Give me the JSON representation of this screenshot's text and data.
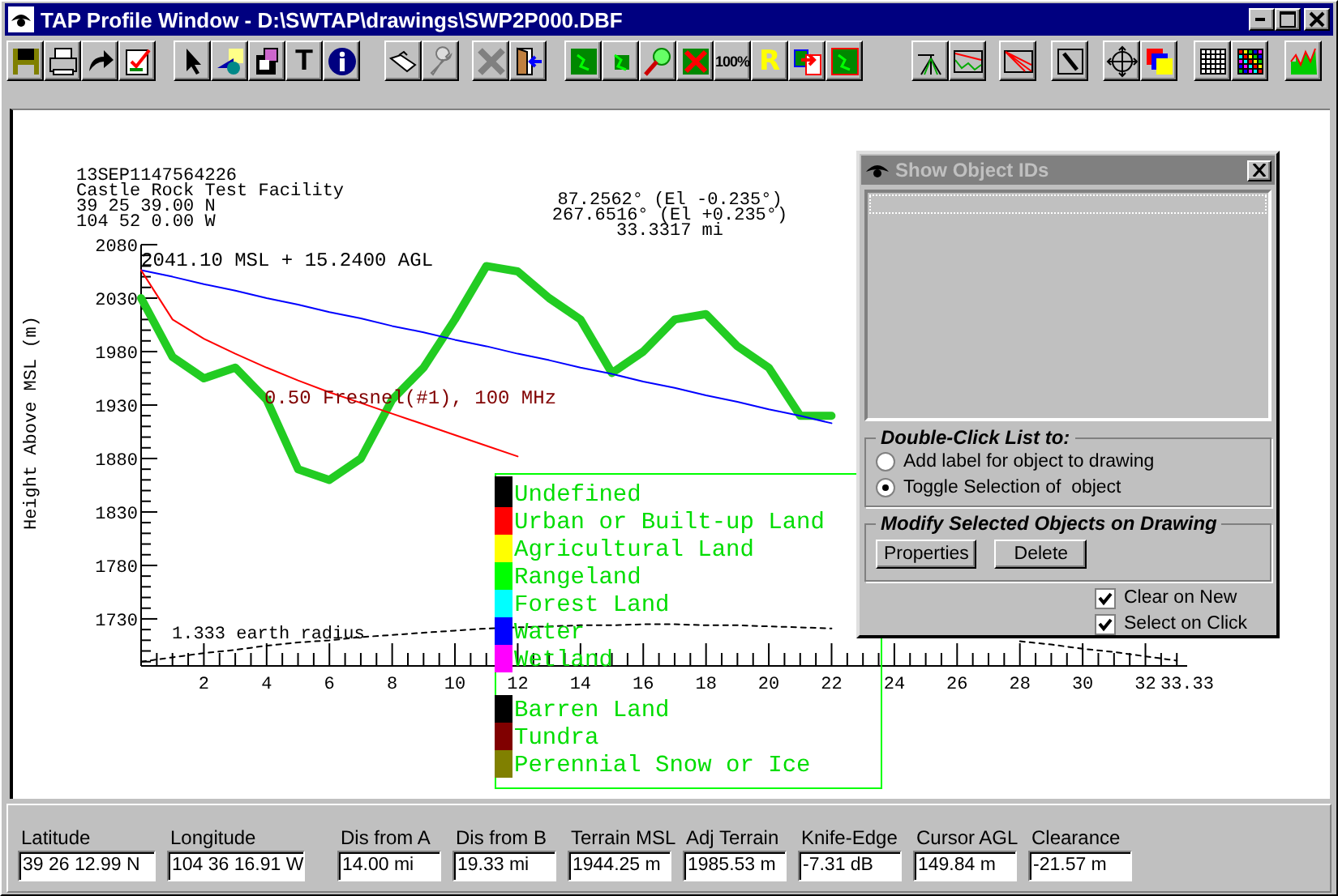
{
  "window": {
    "title": "TAP Profile Window - D:\\SWTAP\\drawings\\SWP2P000.DBF"
  },
  "toolbar": {
    "text_buttons": [
      "T",
      "100%",
      "R"
    ]
  },
  "plot": {
    "header_left": [
      "13SEP1147564226",
      "Castle Rock Test Facility",
      " 39 25 39.00 N",
      "104 52 0.00 W"
    ],
    "header_right": [
      "87.2562° (El -0.235°)",
      "267.6516° (El +0.235°)",
      "33.3317 mi"
    ],
    "antenna_label": "2041.10 MSL + 15.2400 AGL",
    "chart_data": {
      "type": "line",
      "ylabel": "Height Above MSL (m)",
      "x": [
        0,
        1,
        2,
        3,
        4,
        5,
        6,
        7,
        8,
        9,
        10,
        11,
        12,
        13,
        14,
        15,
        16,
        17,
        18,
        19,
        20,
        21,
        22,
        23,
        24,
        25,
        26,
        27,
        28,
        29,
        30,
        31,
        32,
        33
      ],
      "series": [
        {
          "line_style": "solid",
          "color": "#22cc22",
          "values": [
            2030,
            1975,
            1955,
            1965,
            1935,
            1870,
            1860,
            1880,
            1935,
            1965,
            2010,
            2060,
            2055,
            2030,
            2010,
            1960,
            1980,
            2010,
            2015,
            1985,
            1965,
            1920,
            1920,
            null,
            null,
            null,
            null,
            null,
            null,
            null,
            null,
            null,
            null,
            null
          ]
        },
        {
          "line_style": "solid",
          "color": "#0000ff",
          "values": [
            2056,
            2050,
            2043,
            2037,
            2030,
            2024,
            2017,
            2011,
            2004,
            1998,
            1991,
            1985,
            1978,
            1972,
            1965,
            1959,
            1952,
            1946,
            1939,
            1933,
            1926,
            1920,
            1913,
            null,
            null,
            null,
            null,
            null,
            null,
            null,
            null,
            null,
            null,
            null
          ]
        },
        {
          "name": "0.50 Fresnel(#1), 100 MHz",
          "line_style": "solid",
          "color": "#ff0000",
          "values": [
            2056,
            2010,
            1992,
            1978,
            1965,
            1953,
            1942,
            1932,
            1922,
            1912,
            1902,
            1892,
            1882,
            null,
            null,
            null,
            null,
            null,
            null,
            null,
            null,
            null,
            null,
            null,
            null,
            null,
            null,
            null,
            null,
            null,
            null,
            null,
            null,
            null
          ]
        },
        {
          "name": "1.333 earth radius",
          "line_style": "dashed",
          "color": "#000000",
          "values": [
            1690,
            1694,
            1698,
            1701,
            1705,
            1708,
            1710,
            1713,
            1715,
            1717,
            1719,
            1721,
            1722,
            1723,
            1724,
            1724,
            1725,
            1725,
            1724,
            1724,
            1723,
            1722,
            1721,
            null,
            null,
            null,
            null,
            null,
            1709,
            1706,
            1702,
            1699,
            1695,
            1691
          ]
        }
      ],
      "xlim": [
        0,
        33.33
      ],
      "ylim": [
        1686,
        2080
      ],
      "xticks": [
        2,
        4,
        6,
        8,
        10,
        12,
        14,
        16,
        18,
        20,
        22,
        24,
        26,
        28,
        30,
        32,
        {
          "value": 33.33,
          "label": "33.33"
        }
      ],
      "yticks": [
        1730,
        1780,
        1830,
        1880,
        1930,
        1980,
        2030,
        2080
      ]
    },
    "legend": [
      {
        "label": "Undefined",
        "color": "#000000"
      },
      {
        "label": "Urban or Built-up Land",
        "color": "#ff0000"
      },
      {
        "label": "Agricultural Land",
        "color": "#ffff00"
      },
      {
        "label": "Rangeland",
        "color": "#00ff00"
      },
      {
        "label": "Forest Land",
        "color": "#00ffff"
      },
      {
        "label": "Water",
        "color": "#0000ff"
      },
      {
        "label": "Wetland",
        "color": "#ff00ff"
      },
      {
        "label": "Barren Land",
        "color": "#000000"
      },
      {
        "label": "Tundra",
        "color": "#800000"
      },
      {
        "label": "Perennial Snow or Ice",
        "color": "#808000"
      }
    ]
  },
  "dialog": {
    "title": "Show Object IDs",
    "group_1": {
      "title": "Double-Click List to:",
      "options": [
        {
          "label": "Add label for object to drawing",
          "selected": false
        },
        {
          "label": "Toggle Selection of  object",
          "selected": true
        }
      ]
    },
    "group_2": {
      "title": "Modify Selected Objects on Drawing",
      "buttons": [
        "Properties",
        "Delete"
      ]
    },
    "checkboxes": [
      {
        "label": "Clear on New",
        "checked": true
      },
      {
        "label": "Select on Click",
        "checked": true
      }
    ]
  },
  "status_bar": [
    {
      "label": "Latitude",
      "value": "39 26 12.99 N"
    },
    {
      "label": "Longitude",
      "value": "104 36 16.91 W"
    },
    {
      "label": "Dis from A",
      "value": "14.00 mi"
    },
    {
      "label": "Dis from B",
      "value": "19.33 mi"
    },
    {
      "label": "Terrain MSL",
      "value": "1944.25 m"
    },
    {
      "label": "Adj Terrain",
      "value": "1985.53 m"
    },
    {
      "label": "Knife-Edge",
      "value": "-7.31 dB"
    },
    {
      "label": "Cursor AGL",
      "value": "149.84 m"
    },
    {
      "label": "Clearance",
      "value": "-21.57 m"
    }
  ]
}
